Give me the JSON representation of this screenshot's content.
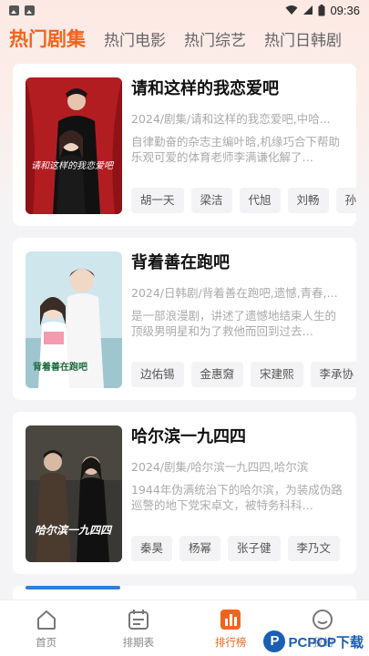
{
  "status_bar": {
    "time": "09:36"
  },
  "tabs": [
    {
      "label": "热门剧集"
    },
    {
      "label": "热门电影"
    },
    {
      "label": "热门综艺"
    },
    {
      "label": "热门日韩剧"
    }
  ],
  "shows": [
    {
      "title": "请和这样的我恋爱吧",
      "meta": "2024/剧集/请和这样的我恋爱吧,中哈...",
      "desc": "自律勤奋的杂志主编叶晗,机缘巧合下帮助乐观可爱的体育老师李满谦化解了…",
      "cast": [
        "胡一天",
        "梁洁",
        "代旭",
        "刘畅",
        "孙"
      ],
      "poster_text": "请和这样的我恋爱吧"
    },
    {
      "title": "背着善在跑吧",
      "meta": "2024/日韩剧/背着善在跑吧,遗憾,青春,...",
      "desc": "是一部浪漫剧，讲述了遗憾地结束人生的顶级男明星和为了救他而回到过去…",
      "cast": [
        "边佑锡",
        "金惠奫",
        "宋建熙",
        "李承协"
      ],
      "poster_text": "背着善在跑吧"
    },
    {
      "title": "哈尔滨一九四四",
      "meta": "2024/剧集/哈尔滨一九四四,哈尔滨",
      "desc": "1944年伪满统治下的哈尔滨，为装成伪路巡警的地下党宋卓文，被特务科科…",
      "cast": [
        "秦昊",
        "杨幂",
        "张子健",
        "李乃文"
      ],
      "poster_text": "哈尔滨一九四四"
    }
  ],
  "bottom_nav": [
    {
      "label": "首页",
      "icon": "home-icon"
    },
    {
      "label": "排期表",
      "icon": "schedule-icon"
    },
    {
      "label": "排行榜",
      "icon": "ranking-icon"
    },
    {
      "label": "我的",
      "icon": "profile-icon"
    }
  ],
  "watermark": {
    "circle": "P",
    "text": "PCPOP下载"
  },
  "colors": {
    "accent": "#f0651d",
    "brand_watermark": "#1a5fb4"
  }
}
